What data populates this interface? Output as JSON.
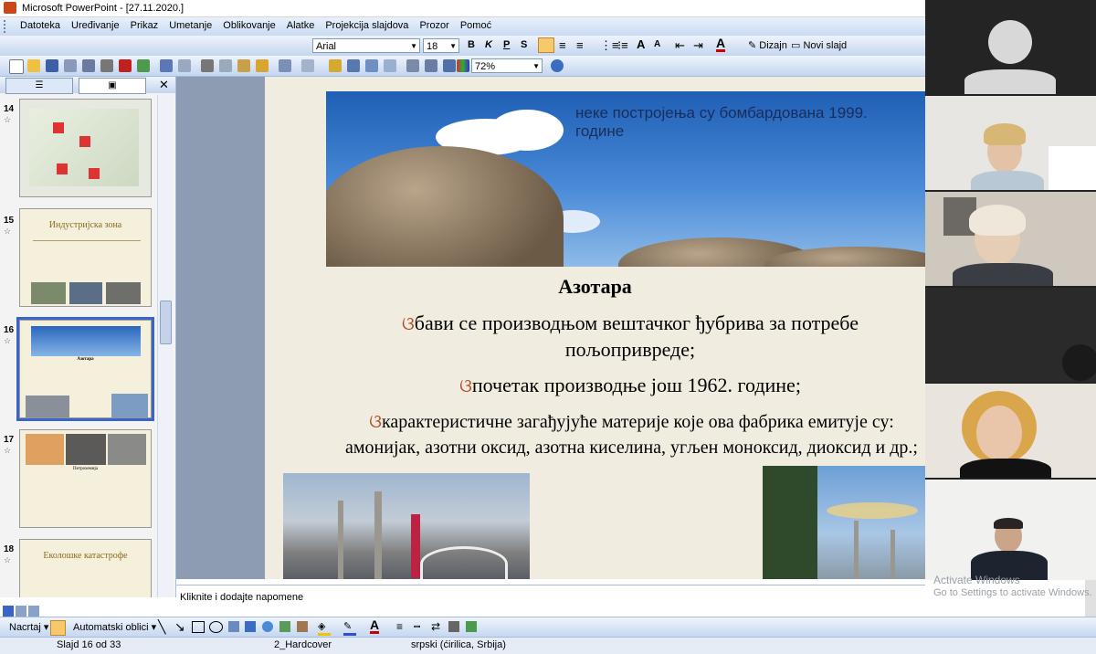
{
  "window": {
    "title": "Microsoft PowerPoint - [27.11.2020.]"
  },
  "menu": [
    "Datoteka",
    "Uređivanje",
    "Prikaz",
    "Umetanje",
    "Oblikovanje",
    "Alatke",
    "Projekcija slajdova",
    "Prozor",
    "Pomoć"
  ],
  "formatting": {
    "font": "Arial",
    "size": "18",
    "bold": "B",
    "italic": "K",
    "underline": "P",
    "shadow": "S",
    "design_label": "Dizajn",
    "new_slide_label": "Novi slajd"
  },
  "standard": {
    "zoom": "72%"
  },
  "pane_tabs": [
    "",
    ""
  ],
  "slides": [
    {
      "num": "14",
      "title": ""
    },
    {
      "num": "15",
      "title": "Индустријска зона"
    },
    {
      "num": "16",
      "title": "Азотара",
      "selected": true
    },
    {
      "num": "17",
      "title": "Петрохемија"
    },
    {
      "num": "18",
      "title": "Еколошке катастрофе"
    }
  ],
  "slide": {
    "caption": "неке постројења су бомбардована 1999. године",
    "title": "Азотара",
    "bullet_mark": "ଓ",
    "bullets": [
      "бави се производњом вештачког ђубрива за потребе пољопривреде;",
      "почетак производње још 1962. године;",
      "карактеристичне загађујуће материје које ова фабрика емитује су: амонијак, азотни оксид, азотна киселина, угљен моноксид, диоксид и др.;"
    ]
  },
  "notes": {
    "placeholder": "Kliknite i dodajte napomene"
  },
  "drawing": {
    "draw_label": "Nacrtaj",
    "autoshapes_label": "Automatski oblici"
  },
  "status": {
    "slide": "Slajd 16 od 33",
    "design": "2_Hardcover",
    "language": "srpski (ćirilica, Srbija)"
  },
  "watermark": {
    "line1": "Activate Windows",
    "line2": "Go to Settings to activate Windows."
  },
  "colors": {
    "accent": "#3a64c8",
    "toolbar": "#c4d6ef",
    "slide_bg": "#f0ece0"
  }
}
